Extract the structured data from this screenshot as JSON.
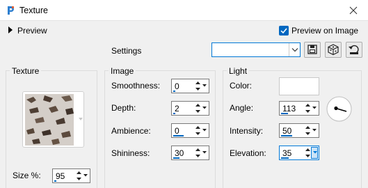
{
  "window": {
    "title": "Texture",
    "icon": "app-logo-icon",
    "close_icon": "close-icon"
  },
  "preview": {
    "label": "Preview",
    "icon": "chevron-right-icon"
  },
  "preview_on_image": {
    "label": "Preview on Image",
    "checked": true
  },
  "settings": {
    "label": "Settings",
    "preset_value": "",
    "buttons": [
      "save-preset-icon",
      "randomize-icon",
      "reset-icon"
    ]
  },
  "texture": {
    "group_title": "Texture",
    "size_label": "Size %:",
    "size_value": "95",
    "size_level": 0.1
  },
  "image": {
    "group_title": "Image",
    "smoothness": {
      "label": "Smoothness:",
      "value": "0",
      "level": 0
    },
    "depth": {
      "label": "Depth:",
      "value": "2",
      "level": 0.1
    },
    "ambience": {
      "label": "Ambience:",
      "value": "0",
      "level": 0.5
    },
    "shininess": {
      "label": "Shininess:",
      "value": "30",
      "level": 0.3
    }
  },
  "light": {
    "group_title": "Light",
    "color_label": "Color:",
    "color_value": "#ffffff",
    "angle": {
      "label": "Angle:",
      "value": "113",
      "level": 0.31
    },
    "intensity": {
      "label": "Intensity:",
      "value": "50",
      "level": 0.5
    },
    "elevation": {
      "label": "Elevation:",
      "value": "35",
      "level": 0.35
    }
  },
  "colors": {
    "accent": "#0067c0",
    "focus": "#0078d7"
  }
}
